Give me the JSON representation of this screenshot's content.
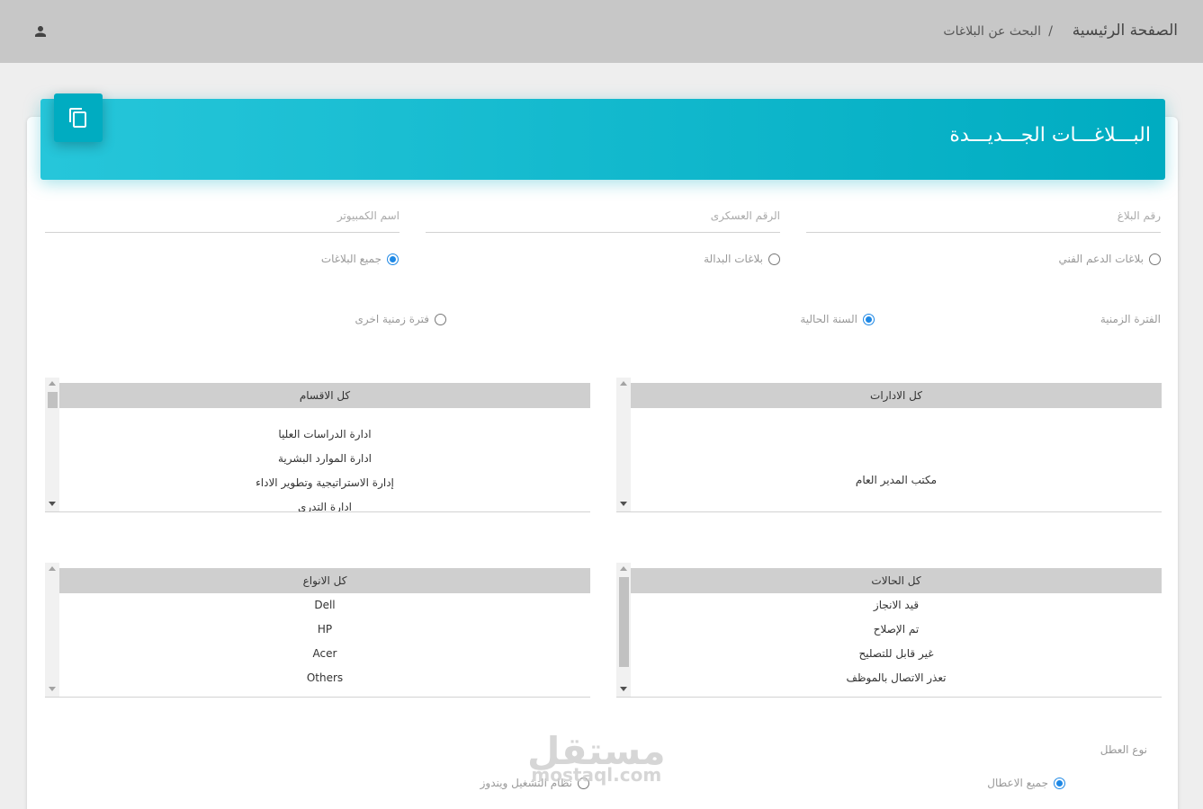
{
  "topbar": {
    "breadcrumb_home": "الصفحة الرئيسية",
    "breadcrumb_separator": "/",
    "breadcrumb_current": "البحث عن البلاغات"
  },
  "header": {
    "title": "البـــلاغـــات الجـــديـــدة",
    "accent_color": "#00acc1"
  },
  "search": {
    "report_number_placeholder": "رقم البلاغ",
    "military_number_placeholder": "الرقم العسكرى",
    "computer_name_placeholder": "اسم الكمبيوتر"
  },
  "report_type": {
    "options": [
      "بلاغات الدعم الفني",
      "بلاغات البدالة",
      "جميع البلاغات"
    ],
    "selected": "جميع البلاغات"
  },
  "time_period": {
    "label": "الفترة الزمنية",
    "options": [
      "السنة الحالية",
      "فترة زمنية اخرى"
    ],
    "selected": "السنة الحالية"
  },
  "departments_list": {
    "header": "كل الادارات",
    "items": [
      "",
      "",
      "",
      "مكتب المدير العام"
    ]
  },
  "sections_list": {
    "header": "كل الاقسام",
    "items": [
      "ادارة الدراسات العليا",
      "ادارة الموارد البشرية",
      "إدارة الاستراتيجية وتطوير الاداء",
      "ادارة التدري"
    ]
  },
  "statuses_list": {
    "header": "كل الحالات",
    "items": [
      "قيد الانجاز",
      "تم الإصلاح",
      "غير قابل للتصليح",
      "تعذر الاتصال بالموظف"
    ]
  },
  "types_list": {
    "header": "كل الانواع",
    "items": [
      "Dell",
      "HP",
      "Acer",
      "Others"
    ]
  },
  "fault_type": {
    "label": "نوع العطل",
    "options": [
      "جميع الاعطال",
      "نظام التشغيل ويندوز"
    ],
    "selected": "جميع الاعطال"
  },
  "watermark": {
    "arabic": "مستقل",
    "latin": "mostaql.com"
  }
}
